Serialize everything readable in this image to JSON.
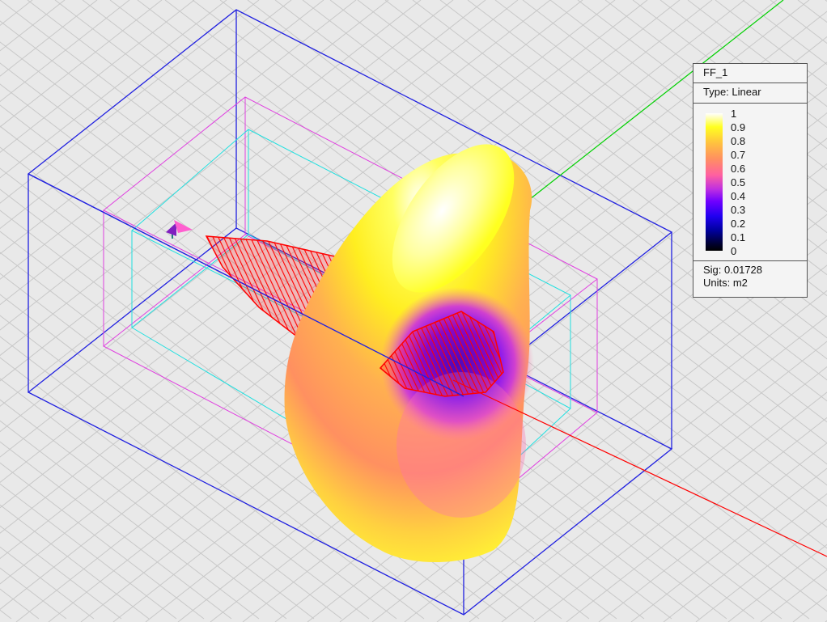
{
  "legend": {
    "title": "FF_1",
    "type": "Type: Linear",
    "ticks": [
      "1",
      "0.9",
      "0.8",
      "0.7",
      "0.6",
      "0.5",
      "0.4",
      "0.3",
      "0.2",
      "0.1",
      "0"
    ],
    "sig": "Sig: 0.01728",
    "units": "Units: m2"
  },
  "colors": {
    "background": "#e9e9e9",
    "outer_box": "#2020e0",
    "middle_box": "#e040e0",
    "inner_box": "#20e0e0",
    "x_axis": "#ff0000",
    "y_axis": "#00d000",
    "mesh": "#ff0000"
  }
}
